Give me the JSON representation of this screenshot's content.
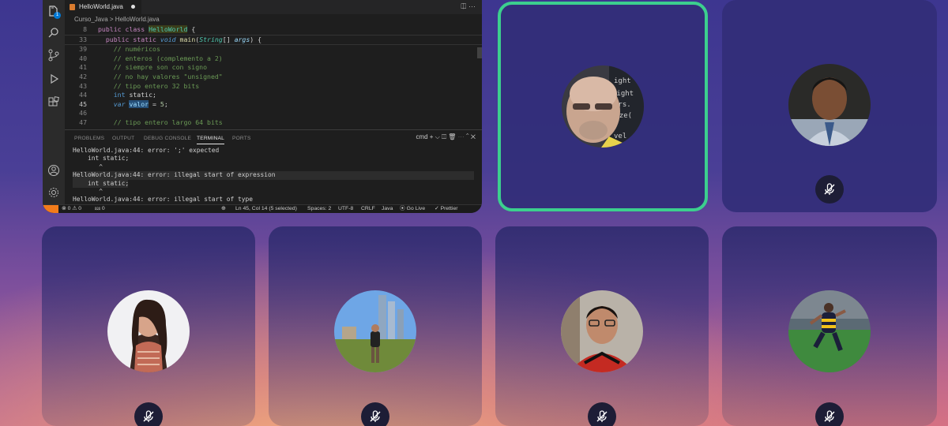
{
  "editor": {
    "tab_label": "HelloWorld.java",
    "tab_actions": "⎅  ⋯",
    "breadcrumb": "Curso_Java  >  HelloWorld.java",
    "lines": [
      {
        "n": "8",
        "t": "public class HelloWorld {"
      },
      {
        "n": "33",
        "t": "  public static void main(String[] args) {"
      },
      {
        "n": "39",
        "t": "    // numéricos"
      },
      {
        "n": "40",
        "t": "    // enteros (complemento a 2)"
      },
      {
        "n": "41",
        "t": "    // siempre son con signo"
      },
      {
        "n": "42",
        "t": "    // no hay valores \"unsigned\""
      },
      {
        "n": "43",
        "t": "    // tipo entero 32 bits"
      },
      {
        "n": "44",
        "t": "    int static;"
      },
      {
        "n": "45",
        "t": "    var valor = 5;"
      },
      {
        "n": "46",
        "t": ""
      },
      {
        "n": "47",
        "t": "    // tipo entero largo 64 bits"
      }
    ],
    "panel_tabs": [
      "PROBLEMS",
      "OUTPUT",
      "DEBUG CONSOLE",
      "TERMINAL",
      "PORTS"
    ],
    "panel_controls": "cmd  +  ⌵  ◫  🗑  ⋯  ⌃  ✕",
    "terminal": [
      "HelloWorld.java:44: error: ';' expected",
      "    int static;",
      "       ^",
      "HelloWorld.java:44: error: illegal start of expression",
      "    int static;",
      "       ^",
      "HelloWorld.java:44: error: illegal start of type"
    ],
    "status": {
      "problems": "⊗ 0 ⚠ 0",
      "ports": "⅏ 0",
      "zoom": "⊕",
      "position": "Ln 45, Col 14 (5 selected)",
      "spaces": "Spaces: 2",
      "encoding": "UTF-8",
      "eol": "CRLF",
      "language": "Java",
      "golive": "⦿ Go Live",
      "prettier": "✓ Prettier"
    },
    "badge": "1"
  },
  "participants": [
    {
      "id": "p1",
      "muted": false,
      "speaking": true
    },
    {
      "id": "p2",
      "muted": true,
      "speaking": false
    },
    {
      "id": "p3",
      "muted": true,
      "speaking": false
    },
    {
      "id": "p4",
      "muted": true,
      "speaking": false
    },
    {
      "id": "p5",
      "muted": true,
      "speaking": false
    },
    {
      "id": "p6",
      "muted": true,
      "speaking": false
    }
  ],
  "colors": {
    "active_border": "#3ccf8e",
    "tile": "#302c70",
    "mute_bg": "#1d1d36"
  }
}
